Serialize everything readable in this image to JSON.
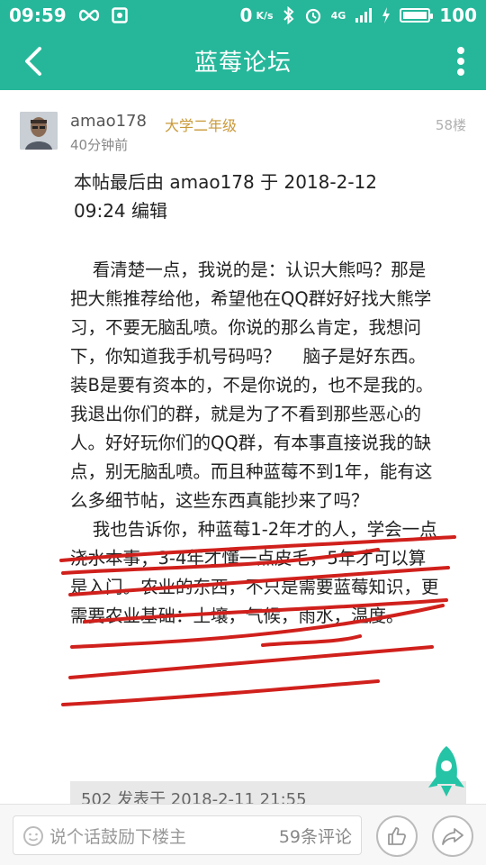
{
  "status_bar": {
    "time": "09:59",
    "network_speed": "0",
    "network_unit": "K/s",
    "signal_label": "4G",
    "battery": "100",
    "battery_level": 1.0
  },
  "app_bar": {
    "title": "蓝莓论坛",
    "back_icon": "chevron-left-icon",
    "menu_icon": "more-vertical-icon"
  },
  "post": {
    "author": "amao178",
    "grade": "大学二年级",
    "time": "40分钟前",
    "floor": "58楼",
    "edit_note": "本帖最后由 amao178 于 2018-2-12 09:24 编辑",
    "content": "    看清楚一点，我说的是：认识大熊吗？那是把大熊推荐给他，希望他在QQ群好好找大熊学习，不要无脑乱喷。你说的那么肯定，我想问下，你知道我手机号码吗？    脑子是好东西。装B是要有资本的，不是你说的，也不是我的。我退出你们的群，就是为了不看到那些恶心的人。好好玩你们的QQ群，有本事直接说我的缺点，别无脑乱喷。而且种蓝莓不到1年，能有这么多细节帖，这些东西真能抄来了吗？\n    我也告诉你，种蓝莓1-2年才的人，学会一点浇水本事；3-4年才懂一点皮毛，5年才可以算是入门。农业的东西，不只是需要蓝莓知识，更需要农业基础：土壤，气候，雨水，温度。",
    "quote_preview": "502 发表于 2018-2-11 21:55"
  },
  "bottom_bar": {
    "reply_placeholder": "说个话鼓励下楼主",
    "comment_count": "59条评论",
    "like_icon": "thumbs-up-icon",
    "share_icon": "share-icon"
  },
  "colors": {
    "brand": "#26b79a",
    "grade": "#c99a3a",
    "ink": "#d0201c"
  }
}
